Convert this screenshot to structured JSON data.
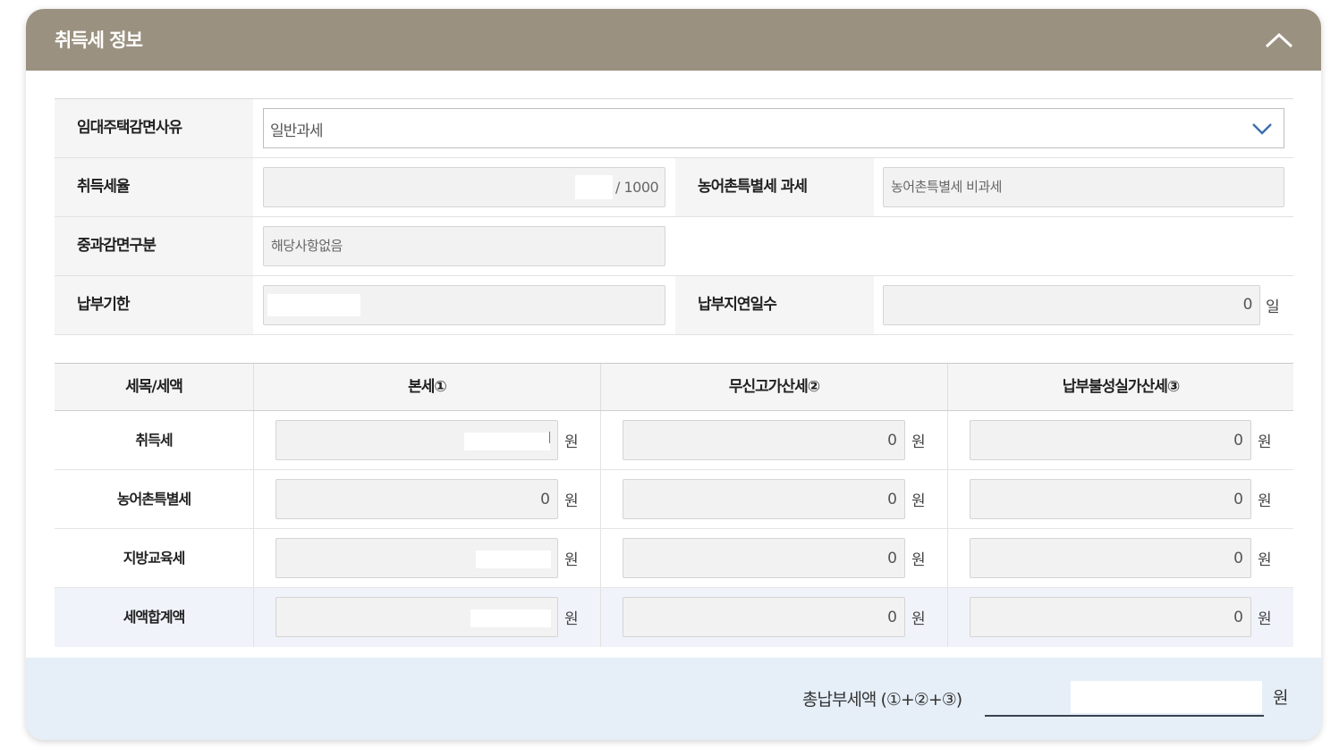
{
  "header": {
    "title": "취득세 정보"
  },
  "info": {
    "exemption_reason": {
      "label": "임대주택감면사유",
      "value": "일반과세"
    },
    "tax_rate": {
      "label": "취득세율",
      "suffix": "/ 1000"
    },
    "rural_tax": {
      "label": "농어촌특별세 과세",
      "value": "농어촌특별세 비과세"
    },
    "surcharge": {
      "label": "중과감면구분",
      "value": "해당사항없음"
    },
    "due_date": {
      "label": "납부기한"
    },
    "late_days": {
      "label": "납부지연일수",
      "value": "0",
      "unit": "일"
    }
  },
  "tax_table": {
    "headers": [
      "세목/세액",
      "본세①",
      "무신고가산세②",
      "납부불성실가산세③"
    ],
    "unit": "원",
    "rows": [
      {
        "label": "취득세",
        "base": "",
        "no_report": "0",
        "late": "0"
      },
      {
        "label": "농어촌특별세",
        "base": "0",
        "no_report": "0",
        "late": "0"
      },
      {
        "label": "지방교육세",
        "base": "",
        "no_report": "0",
        "late": "0"
      },
      {
        "label": "세액합계액",
        "base": "",
        "no_report": "0",
        "late": "0"
      }
    ]
  },
  "footer": {
    "label": "총납부세액 (①+②+③)",
    "unit": "원"
  }
}
